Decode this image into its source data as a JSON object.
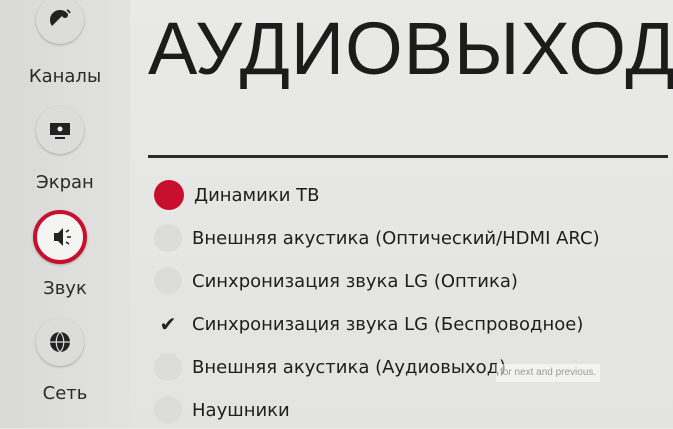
{
  "sidebar": {
    "items": [
      {
        "label": "Каналы",
        "icon": "satellite-dish-icon",
        "active": false
      },
      {
        "label": "Экран",
        "icon": "screen-icon",
        "active": false
      },
      {
        "label": "Звук",
        "icon": "speaker-icon",
        "active": true
      },
      {
        "label": "Сеть",
        "icon": "globe-icon",
        "active": false
      }
    ]
  },
  "page": {
    "title": "АУДИОВЫХОД"
  },
  "options": [
    {
      "label": "Динамики ТВ",
      "state": "selected"
    },
    {
      "label": "Внешняя акустика (Оптический/HDMI ARC)",
      "state": "none"
    },
    {
      "label": "Синхронизация звука LG (Оптика)",
      "state": "none"
    },
    {
      "label": "Синхронизация звука LG (Беспроводное)",
      "state": "checked"
    },
    {
      "label": "Внешняя акустика (Аудиовыход)",
      "state": "none"
    },
    {
      "label": "Наушники",
      "state": "none"
    }
  ],
  "tooltip": {
    "text": "for next and previous."
  },
  "colors": {
    "accent": "#c8102e",
    "background": "#e6e6e4"
  }
}
